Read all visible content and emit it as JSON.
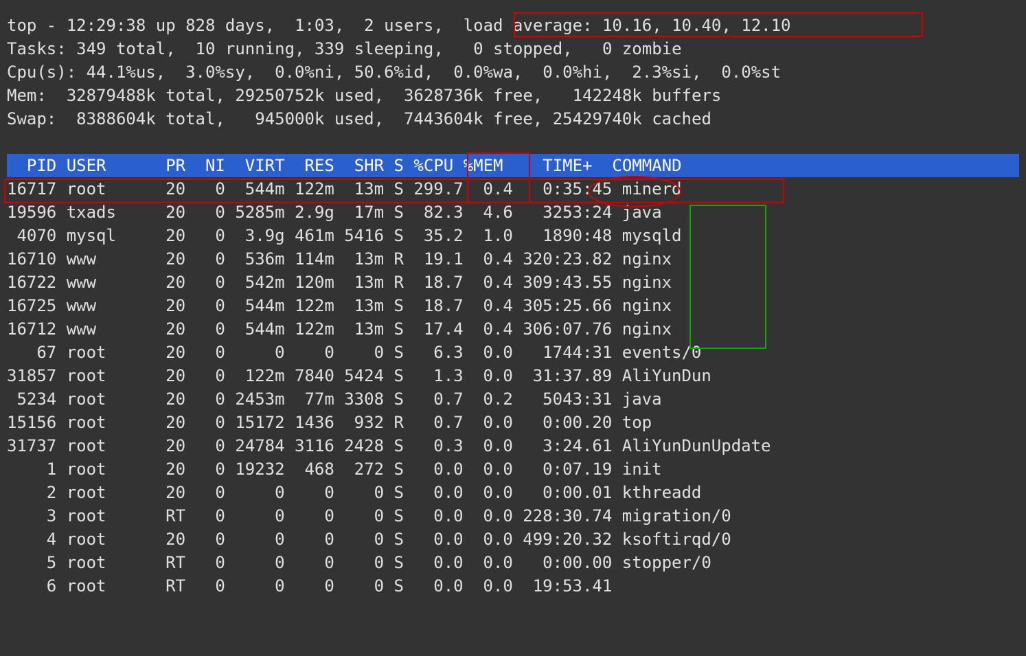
{
  "summary": {
    "line1a": "top - 12:29:38 up 828 days,  1:03,  2 users,  ",
    "line1b": "load average: 10.16, 10.40, 12.10",
    "line2": "Tasks: 349 total,  10 running, 339 sleeping,   0 stopped,   0 zombie",
    "line3": "Cpu(s): 44.1%us,  3.0%sy,  0.0%ni, 50.6%id,  0.0%wa,  0.0%hi,  2.3%si,  0.0%st",
    "line4": "Mem:  32879488k total, 29250752k used,  3628736k free,   142248k buffers",
    "line5": "Swap:  8388604k total,   945000k used,  7443604k free, 25429740k cached"
  },
  "header": "  PID USER      PR  NI  VIRT  RES  SHR S %CPU %MEM    TIME+  COMMAND                                      ",
  "cols": [
    "PID",
    "USER",
    "PR",
    "NI",
    "VIRT",
    "RES",
    "SHR",
    "S",
    "%CPU",
    "%MEM",
    "TIME+",
    "COMMAND"
  ],
  "rows": [
    {
      "pid": "16717",
      "user": "root",
      "pr": "20",
      "ni": "0",
      "virt": "544m",
      "res": "122m",
      "shr": "13m",
      "s": "S",
      "cpu": "299.7",
      "mem": "0.4",
      "time": "0:35:45",
      "cmd": "minerd"
    },
    {
      "pid": "19596",
      "user": "txads",
      "pr": "20",
      "ni": "0",
      "virt": "5285m",
      "res": "2.9g",
      "shr": "17m",
      "s": "S",
      "cpu": "82.3",
      "mem": "4.6",
      "time": "3253:24",
      "cmd": "java"
    },
    {
      "pid": "4070",
      "user": "mysql",
      "pr": "20",
      "ni": "0",
      "virt": "3.9g",
      "res": "461m",
      "shr": "5416",
      "s": "S",
      "cpu": "35.2",
      "mem": "1.0",
      "time": "1890:48",
      "cmd": "mysqld"
    },
    {
      "pid": "16710",
      "user": "www",
      "pr": "20",
      "ni": "0",
      "virt": "536m",
      "res": "114m",
      "shr": "13m",
      "s": "R",
      "cpu": "19.1",
      "mem": "0.4",
      "time": "320:23.82",
      "cmd": "nginx"
    },
    {
      "pid": "16722",
      "user": "www",
      "pr": "20",
      "ni": "0",
      "virt": "542m",
      "res": "120m",
      "shr": "13m",
      "s": "R",
      "cpu": "18.7",
      "mem": "0.4",
      "time": "309:43.55",
      "cmd": "nginx"
    },
    {
      "pid": "16725",
      "user": "www",
      "pr": "20",
      "ni": "0",
      "virt": "544m",
      "res": "122m",
      "shr": "13m",
      "s": "S",
      "cpu": "18.7",
      "mem": "0.4",
      "time": "305:25.66",
      "cmd": "nginx"
    },
    {
      "pid": "16712",
      "user": "www",
      "pr": "20",
      "ni": "0",
      "virt": "544m",
      "res": "122m",
      "shr": "13m",
      "s": "S",
      "cpu": "17.4",
      "mem": "0.4",
      "time": "306:07.76",
      "cmd": "nginx"
    },
    {
      "pid": "67",
      "user": "root",
      "pr": "20",
      "ni": "0",
      "virt": "0",
      "res": "0",
      "shr": "0",
      "s": "S",
      "cpu": "6.3",
      "mem": "0.0",
      "time": "1744:31",
      "cmd": "events/0"
    },
    {
      "pid": "31857",
      "user": "root",
      "pr": "20",
      "ni": "0",
      "virt": "122m",
      "res": "7840",
      "shr": "5424",
      "s": "S",
      "cpu": "1.3",
      "mem": "0.0",
      "time": "31:37.89",
      "cmd": "AliYunDun"
    },
    {
      "pid": "5234",
      "user": "root",
      "pr": "20",
      "ni": "0",
      "virt": "2453m",
      "res": "77m",
      "shr": "3308",
      "s": "S",
      "cpu": "0.7",
      "mem": "0.2",
      "time": "5043:31",
      "cmd": "java"
    },
    {
      "pid": "15156",
      "user": "root",
      "pr": "20",
      "ni": "0",
      "virt": "15172",
      "res": "1436",
      "shr": "932",
      "s": "R",
      "cpu": "0.7",
      "mem": "0.0",
      "time": "0:00.20",
      "cmd": "top"
    },
    {
      "pid": "31737",
      "user": "root",
      "pr": "20",
      "ni": "0",
      "virt": "24784",
      "res": "3116",
      "shr": "2428",
      "s": "S",
      "cpu": "0.3",
      "mem": "0.0",
      "time": "3:24.61",
      "cmd": "AliYunDunUpdate"
    },
    {
      "pid": "1",
      "user": "root",
      "pr": "20",
      "ni": "0",
      "virt": "19232",
      "res": "468",
      "shr": "272",
      "s": "S",
      "cpu": "0.0",
      "mem": "0.0",
      "time": "0:07.19",
      "cmd": "init"
    },
    {
      "pid": "2",
      "user": "root",
      "pr": "20",
      "ni": "0",
      "virt": "0",
      "res": "0",
      "shr": "0",
      "s": "S",
      "cpu": "0.0",
      "mem": "0.0",
      "time": "0:00.01",
      "cmd": "kthreadd"
    },
    {
      "pid": "3",
      "user": "root",
      "pr": "RT",
      "ni": "0",
      "virt": "0",
      "res": "0",
      "shr": "0",
      "s": "S",
      "cpu": "0.0",
      "mem": "0.0",
      "time": "228:30.74",
      "cmd": "migration/0"
    },
    {
      "pid": "4",
      "user": "root",
      "pr": "20",
      "ni": "0",
      "virt": "0",
      "res": "0",
      "shr": "0",
      "s": "S",
      "cpu": "0.0",
      "mem": "0.0",
      "time": "499:20.32",
      "cmd": "ksoftirqd/0"
    },
    {
      "pid": "5",
      "user": "root",
      "pr": "RT",
      "ni": "0",
      "virt": "0",
      "res": "0",
      "shr": "0",
      "s": "S",
      "cpu": "0.0",
      "mem": "0.0",
      "time": "0:00.00",
      "cmd": "stopper/0"
    },
    {
      "pid": "6",
      "user": "root",
      "pr": "RT",
      "ni": "0",
      "virt": "0",
      "res": "0",
      "shr": "0",
      "s": "S",
      "cpu": "0.0",
      "mem": "0.0",
      "time": "19:53.41",
      "cmd": ""
    }
  ]
}
